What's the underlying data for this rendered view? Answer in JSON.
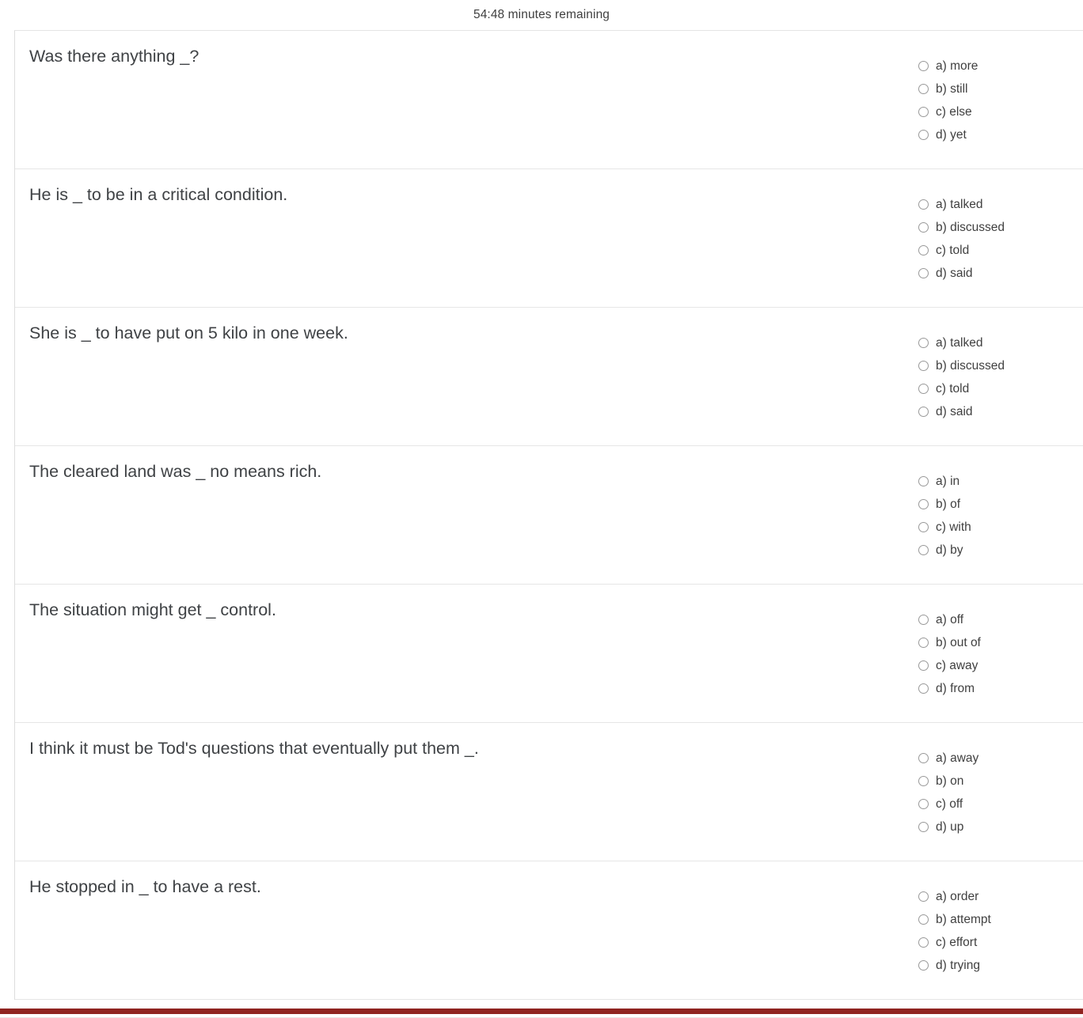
{
  "timer": {
    "text": "54:48 minutes remaining"
  },
  "colors": {
    "bottom_bar": "#8f2420",
    "text": "#3f4245",
    "border": "#e6e6e6",
    "radio_border": "#999999"
  },
  "quiz": {
    "questions": [
      {
        "text": "Was there anything _?",
        "options": [
          {
            "label": "a) more"
          },
          {
            "label": "b) still"
          },
          {
            "label": "c) else"
          },
          {
            "label": "d) yet"
          }
        ]
      },
      {
        "text": "He is _ to be in a critical condition.",
        "options": [
          {
            "label": "a) talked"
          },
          {
            "label": "b) discussed"
          },
          {
            "label": "c) told"
          },
          {
            "label": "d) said"
          }
        ]
      },
      {
        "text": "She is _ to have put on 5 kilo in one week.",
        "options": [
          {
            "label": "a) talked"
          },
          {
            "label": "b) discussed"
          },
          {
            "label": "c) told"
          },
          {
            "label": "d) said"
          }
        ]
      },
      {
        "text": "The cleared land was _ no means rich.",
        "options": [
          {
            "label": "a) in"
          },
          {
            "label": "b) of"
          },
          {
            "label": "c) with"
          },
          {
            "label": "d) by"
          }
        ]
      },
      {
        "text": "The situation might get _ control.",
        "options": [
          {
            "label": "a) off"
          },
          {
            "label": "b) out of"
          },
          {
            "label": "c) away"
          },
          {
            "label": "d) from"
          }
        ]
      },
      {
        "text": "I think it must be Tod's questions that eventually put them _.",
        "options": [
          {
            "label": "a) away"
          },
          {
            "label": "b) on"
          },
          {
            "label": "c) off"
          },
          {
            "label": "d) up"
          }
        ]
      },
      {
        "text": "He stopped in _ to have a rest.",
        "options": [
          {
            "label": "a) order"
          },
          {
            "label": "b) attempt"
          },
          {
            "label": "c) effort"
          },
          {
            "label": "d) trying"
          }
        ]
      }
    ]
  }
}
